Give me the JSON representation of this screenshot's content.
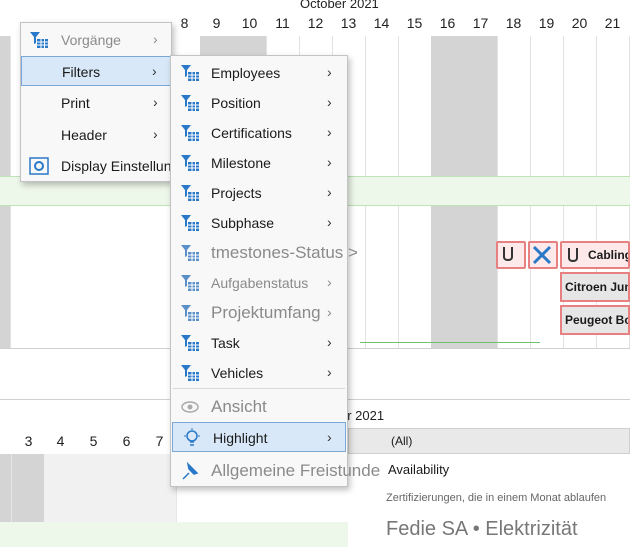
{
  "calendar": {
    "month_label": "October 2021",
    "top_days": [
      "8",
      "9",
      "10",
      "11",
      "12",
      "13",
      "14",
      "15",
      "16",
      "17",
      "18",
      "19",
      "20",
      "21"
    ],
    "bottom_month_label": "er 2021",
    "bottom_days": [
      "3",
      "4",
      "5",
      "6",
      "7"
    ],
    "filter_value": "(All)",
    "availability_label": "Availability",
    "tooltip_small": "Zertifizierungen, die in einem Monat ablaufen",
    "tooltip_large": "Fedie SA • Elektrizität",
    "bar_labels": [
      "Cabling",
      "Citroen Jum",
      "Peugeot Bo"
    ]
  },
  "menu1": {
    "items": [
      {
        "label": "Vorgänge",
        "arrow": "›",
        "icon": "filter-icon"
      },
      {
        "label": "Filters",
        "arrow": "›",
        "icon": ""
      },
      {
        "label": "Print",
        "arrow": "›",
        "icon": ""
      },
      {
        "label": "Header",
        "arrow": "›",
        "icon": ""
      },
      {
        "label": "Display Einstellungen",
        "arrow": "",
        "icon": "gear-icon"
      }
    ]
  },
  "menu2": {
    "items": [
      {
        "label": "Employees",
        "arrow": "›"
      },
      {
        "label": "Position",
        "arrow": "›"
      },
      {
        "label": "Certifications",
        "arrow": "›"
      },
      {
        "label": "Milestone",
        "arrow": "›"
      },
      {
        "label": "Projects",
        "arrow": "›"
      },
      {
        "label": "Subphase",
        "arrow": "›"
      },
      {
        "label": "tmestones-Status >",
        "arrow": ""
      },
      {
        "label": "Aufgabenstatus",
        "arrow": "›"
      },
      {
        "label": "Projektumfang",
        "arrow": "›"
      },
      {
        "label": "Task",
        "arrow": "›"
      },
      {
        "label": "Vehicles",
        "arrow": "›"
      },
      {
        "label": "Ansicht",
        "arrow": ""
      },
      {
        "label": "Highlight",
        "arrow": "›"
      },
      {
        "label": "Allgemeine Freistunde",
        "arrow": ""
      }
    ]
  },
  "colors": {
    "accent": "#2a78c8",
    "highlight_bg": "#d8e8f8",
    "weekend": "#d4d4d4",
    "green_row": "#eef8ea",
    "tag_border": "#e78080"
  }
}
